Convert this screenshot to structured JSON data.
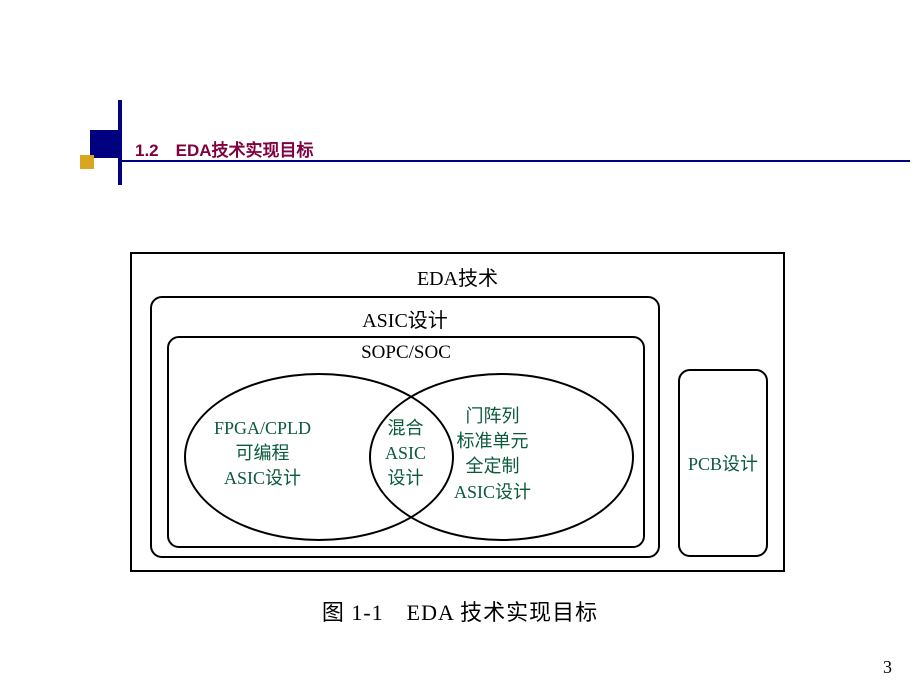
{
  "header": {
    "section_number": "1.2",
    "title": "EDA技术实现目标"
  },
  "diagram": {
    "outer_label": "EDA技术",
    "asic_label": "ASIC设计",
    "sopc_label": "SOPC/SOC",
    "left_ellipse": {
      "line1": "FPGA/CPLD",
      "line2": "可编程",
      "line3": "ASIC设计"
    },
    "mixed": {
      "line1": "混合",
      "line2": "ASIC",
      "line3": "设计"
    },
    "right_ellipse": {
      "line1": "门阵列",
      "line2": "标准单元",
      "line3": "全定制",
      "line4": "ASIC设计"
    },
    "pcb_label": "PCB设计"
  },
  "caption": "图 1-1　EDA 技术实现目标",
  "page_number": "3"
}
